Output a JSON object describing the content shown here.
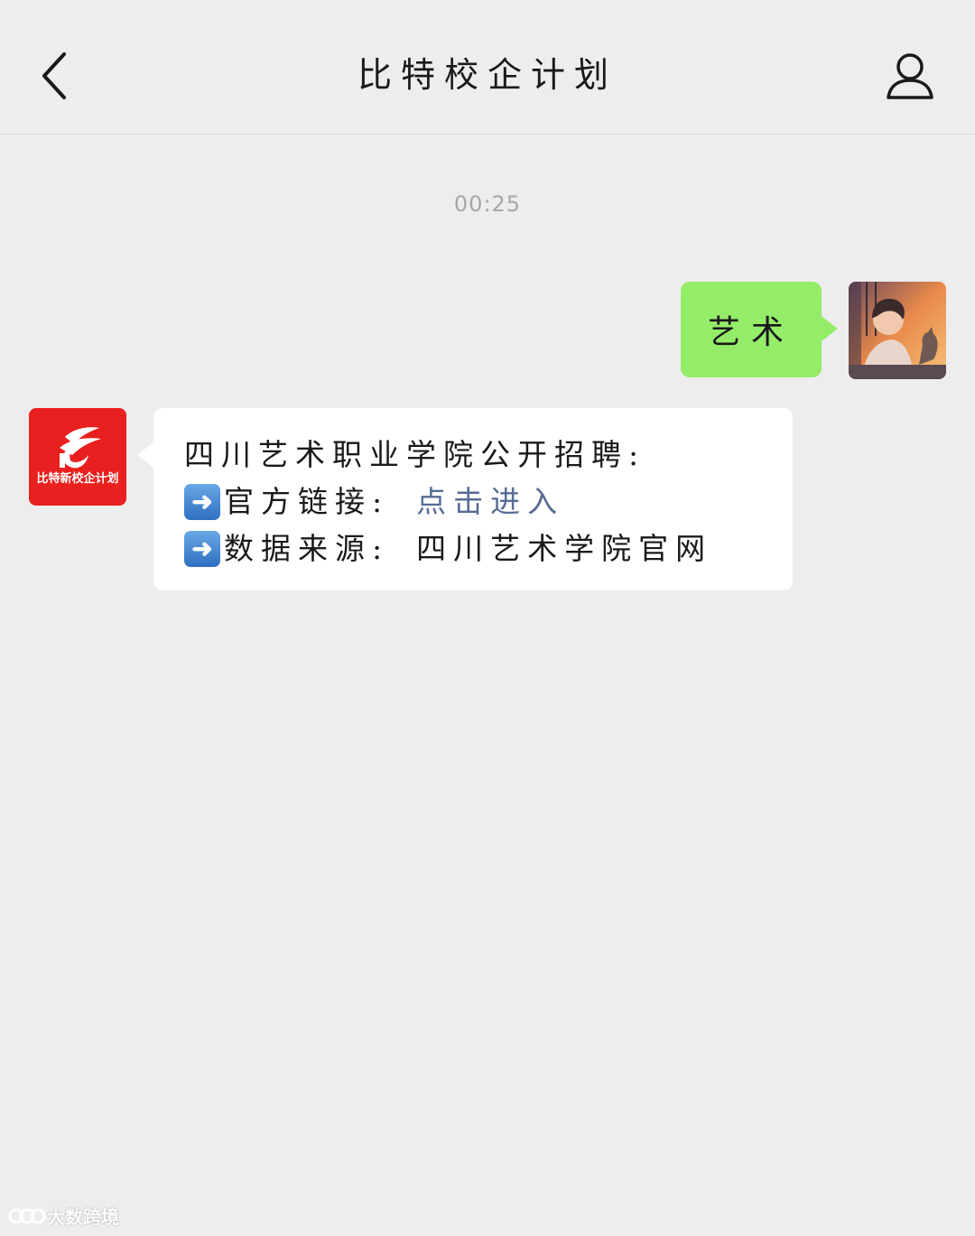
{
  "header": {
    "title": "比特校企计划"
  },
  "chat": {
    "timestamp": "00:25",
    "messages": [
      {
        "side": "right",
        "text": "艺术"
      },
      {
        "side": "left",
        "brand_avatar_text": "比特新校企计划",
        "line1": "四川艺术职业学院公开招聘:",
        "line2_prefix": "官方链接:",
        "line2_link": "点击进入",
        "line3_prefix": "数据来源:",
        "line3_value": "四川艺术学院官网"
      }
    ]
  },
  "watermark": {
    "text": "大数跨境"
  },
  "colors": {
    "background": "#ededed",
    "bubble_self": "#95ec69",
    "bubble_other": "#ffffff",
    "link": "#576b95",
    "brand_red": "#e8201f"
  }
}
